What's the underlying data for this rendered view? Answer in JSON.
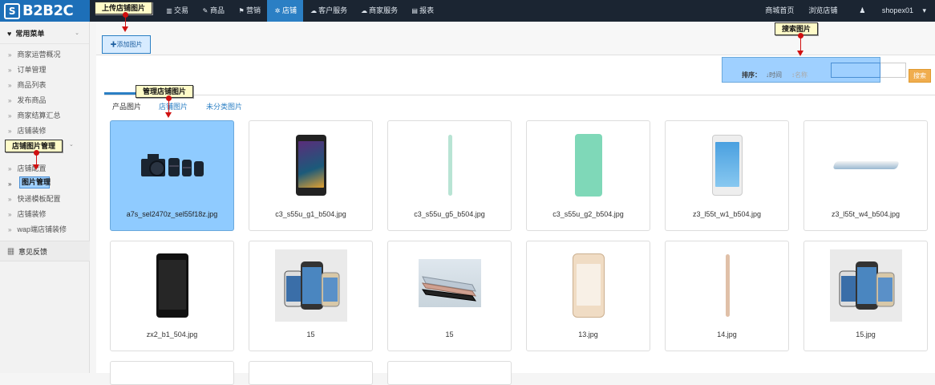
{
  "header": {
    "logo_text": "B2B2C",
    "nav": [
      {
        "icon": "chart-icon",
        "glyph": "▥",
        "label": "交易"
      },
      {
        "icon": "tag-icon",
        "glyph": "✎",
        "label": "商品"
      },
      {
        "icon": "flag-icon",
        "glyph": "⚑",
        "label": "营销"
      },
      {
        "icon": "gear-icon",
        "glyph": "✲",
        "label": "店铺"
      },
      {
        "icon": "chat-icon",
        "glyph": "☁",
        "label": "客户服务"
      },
      {
        "icon": "cloud-icon",
        "glyph": "☁",
        "label": "商家服务"
      },
      {
        "icon": "report-icon",
        "glyph": "▤",
        "label": "报表"
      }
    ],
    "active_nav": "店铺",
    "right_links": [
      "商城首页",
      "浏览店铺"
    ],
    "user": "shopex01"
  },
  "sidebar": {
    "common_menu_title": "常用菜单",
    "common_items": [
      "商家运营概况",
      "订单管理",
      "商品列表",
      "发布商品",
      "商家结算汇总",
      "店铺装修"
    ],
    "shop_section_items": [
      "店铺配置",
      "图片管理",
      "快递模板配置",
      "店铺装修",
      "wap端店铺装修"
    ],
    "feedback_title": "意见反馈"
  },
  "toolbar": {
    "add_button": "✚添加图片",
    "sort_label": "排序：",
    "sort_time": "↓时间",
    "sort_name": "↕名称",
    "search_button": "搜索"
  },
  "tabs": [
    "产品图片",
    "店铺图片",
    "未分类图片"
  ],
  "images": [
    {
      "name": "a7s_sel2470z_sel55f18z.jpg"
    },
    {
      "name": "c3_s55u_g1_b504.jpg"
    },
    {
      "name": "c3_s55u_g5_b504.jpg"
    },
    {
      "name": "c3_s55u_g2_b504.jpg"
    },
    {
      "name": "z3_l55t_w1_b504.jpg"
    },
    {
      "name": "z3_l55t_w4_b504.jpg"
    },
    {
      "name": "zx2_b1_504.jpg"
    },
    {
      "name": "15"
    },
    {
      "name": "15"
    },
    {
      "name": "13.jpg"
    },
    {
      "name": "14.jpg"
    },
    {
      "name": "15.jpg"
    }
  ],
  "annotations": {
    "upload": "上传店铺图片",
    "search": "搜索图片",
    "manage": "管理店铺图片",
    "shop_manage": "店铺图片管理"
  },
  "colors": {
    "topbar": "#1b2532",
    "active": "#2b7fc4",
    "highlight": "#8fcbff",
    "callout_bg": "#fffbc8",
    "arrow": "#d01010",
    "search_button": "#f0ad4e"
  }
}
